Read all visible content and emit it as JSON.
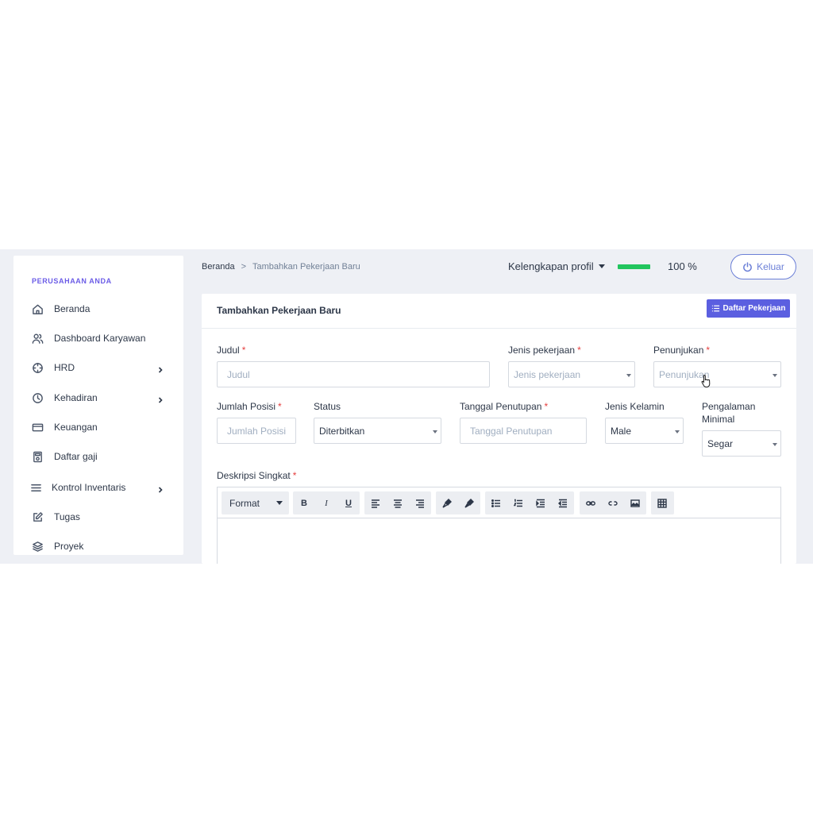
{
  "sidebar": {
    "title": "PERUSAHAAN ANDA",
    "items": [
      {
        "label": "Beranda",
        "icon": "home-icon"
      },
      {
        "label": "Dashboard Karyawan",
        "icon": "users-icon"
      },
      {
        "label": "HRD",
        "icon": "crosshair-icon",
        "has_submenu": true
      },
      {
        "label": "Kehadiran",
        "icon": "clock-icon",
        "has_submenu": true
      },
      {
        "label": "Keuangan",
        "icon": "credit-card-icon"
      },
      {
        "label": "Daftar gaji",
        "icon": "calculator-icon"
      },
      {
        "label": "Kontrol Inventaris",
        "icon": "menu-icon",
        "has_submenu": true
      },
      {
        "label": "Tugas",
        "icon": "edit-icon"
      },
      {
        "label": "Proyek",
        "icon": "layers-icon"
      }
    ]
  },
  "header": {
    "breadcrumb": {
      "home": "Beranda",
      "separator": ">",
      "current": "Tambahkan Pekerjaan Baru"
    },
    "profile_label": "Kelengkapan profil",
    "progress_fraction": 1.0,
    "progress_text": "100 %",
    "progress_color": "#22c55e",
    "logout_label": "Keluar"
  },
  "card": {
    "title": "Tambahkan Pekerjaan Baru",
    "list_button": "Daftar Pekerjaan",
    "accent": "#5b5fe0"
  },
  "form": {
    "judul": {
      "label": "Judul",
      "placeholder": "Judul"
    },
    "jenis_pekerjaan": {
      "label": "Jenis pekerjaan",
      "placeholder": "Jenis pekerjaan"
    },
    "penunjukan": {
      "label": "Penunjukan",
      "placeholder": "Penunjukan"
    },
    "jumlah_posisi": {
      "label": "Jumlah Posisi",
      "placeholder": "Jumlah Posisi"
    },
    "status": {
      "label": "Status",
      "value": "Diterbitkan"
    },
    "tanggal_penutupan": {
      "label": "Tanggal Penutupan",
      "placeholder": "Tanggal Penutupan"
    },
    "jenis_kelamin": {
      "label": "Jenis Kelamin",
      "value": "Male"
    },
    "pengalaman_minimal": {
      "label_line1": "Pengalaman",
      "label_line2": "Minimal",
      "value": "Segar"
    },
    "deskripsi": {
      "label": "Deskripsi Singkat"
    },
    "required_mark": "*"
  },
  "editor": {
    "format_label": "Format",
    "bold": "B",
    "italic": "I",
    "underline": "U"
  }
}
